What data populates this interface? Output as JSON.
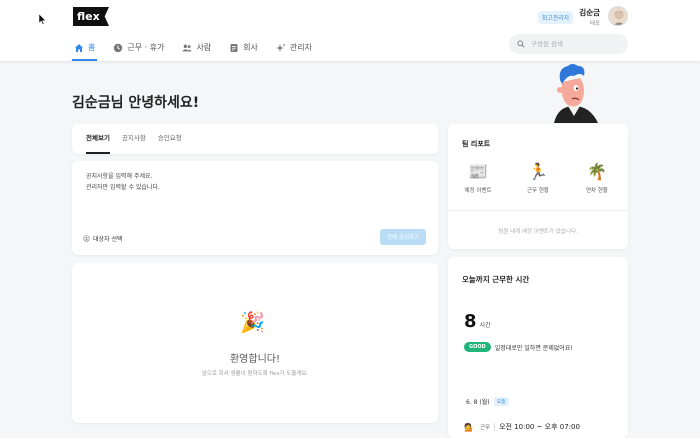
{
  "header": {
    "logo_text": "flex",
    "role_badge": "최고관리자",
    "user_name": "김순금",
    "user_company": "테포",
    "nav": [
      {
        "label": "홈",
        "icon": "home-icon",
        "active": true
      },
      {
        "label": "근무 · 휴가",
        "icon": "clock-icon",
        "active": false
      },
      {
        "label": "사람",
        "icon": "people-icon",
        "active": false
      },
      {
        "label": "회사",
        "icon": "document-icon",
        "active": false
      },
      {
        "label": "관리자",
        "icon": "sparkle-icon",
        "active": false
      }
    ],
    "search_placeholder": "구성원 검색"
  },
  "main": {
    "greeting": "김순금님 안녕하세요!",
    "tabs": [
      "전체보기",
      "공지사항",
      "승인요청"
    ],
    "notice_text": "공지사항을 입력해 주세요.\n관리자만 입력할 수 있습니다.",
    "target_select": "대상자 선택",
    "notice_button": "전체 공지하기",
    "welcome_emoji": "🎉",
    "welcome_title": "환영합니다!",
    "welcome_sub": "앞으로 회사 생활이 편하도록 flex가 도울게요."
  },
  "team_report": {
    "title": "팀 리포트",
    "items": [
      {
        "label": "예정 이벤트",
        "emoji": "📰"
      },
      {
        "label": "근무 현황",
        "emoji": "🏃"
      },
      {
        "label": "연차 현황",
        "emoji": "🌴"
      }
    ],
    "empty_text": "팀원 내게 예정 이벤트가 없습니다."
  },
  "work_time": {
    "title": "오늘까지 근무한 시간",
    "hours": "8",
    "hours_unit": "시간",
    "good_badge": "GOOD",
    "good_text": "일정대로만 일하면 문제없어요!",
    "date": "6. 8 (월)",
    "today_badge": "오늘",
    "shift_label": "근무",
    "shift_time": "오전 10:00 ~ 오후 07:00",
    "shift_emoji": "💁"
  },
  "colors": {
    "accent": "#2e8ae6",
    "good": "#1fb57a",
    "button_disabled": "#b9dcf7"
  }
}
